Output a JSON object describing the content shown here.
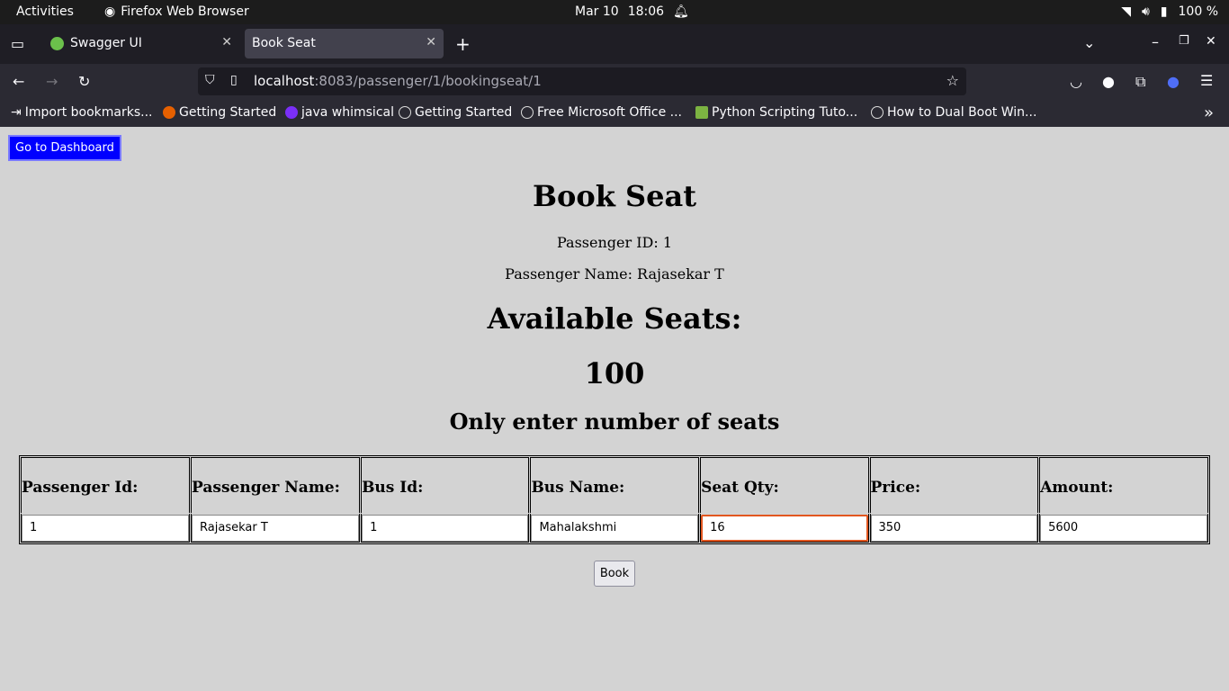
{
  "system_bar": {
    "activities": "Activities",
    "app_name": "Firefox Web Browser",
    "date": "Mar 10",
    "time": "18:06",
    "battery": "100 %"
  },
  "browser": {
    "tabs": [
      {
        "label": "Swagger UI"
      },
      {
        "label": "Book Seat"
      }
    ],
    "url_host": "localhost",
    "url_path": ":8083/passenger/1/bookingseat/1",
    "bookmarks": [
      {
        "label": "Import bookmarks..."
      },
      {
        "label": "Getting Started"
      },
      {
        "label": "java whimsical"
      },
      {
        "label": "Getting Started"
      },
      {
        "label": "Free Microsoft Office ..."
      },
      {
        "label": "Python Scripting Tuto..."
      },
      {
        "label": "How to Dual Boot Win..."
      }
    ]
  },
  "page": {
    "dashboard_button": "Go to Dashboard",
    "title": "Book Seat",
    "passenger_id_line": "Passenger ID: 1",
    "passenger_name_line": "Passenger Name: Rajasekar T",
    "available_heading": "Available Seats:",
    "available_value": "100",
    "note": "Only enter number of seats",
    "table": {
      "headers": [
        "Passenger Id:",
        "Passenger Name:",
        "Bus Id:",
        "Bus Name:",
        "Seat Qty:",
        "Price:",
        "Amount:"
      ],
      "values": [
        "1",
        "Rajasekar T",
        "1",
        "Mahalakshmi",
        "16",
        "350",
        "5600"
      ]
    },
    "book_button": "Book"
  }
}
